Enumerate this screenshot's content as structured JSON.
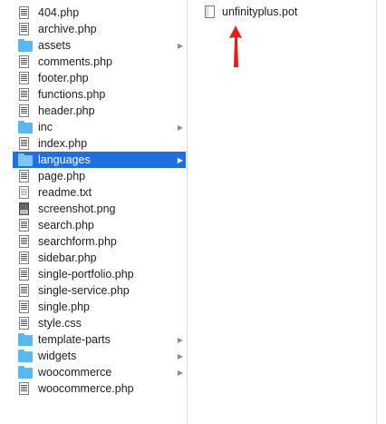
{
  "window": {
    "colors": {
      "selection": "#1f6fe0",
      "folder": "#5ab7f0",
      "arrow": "#e0201a"
    }
  },
  "left_column": {
    "items": [
      {
        "name": "404.php",
        "kind": "php",
        "icon": "php-file-icon",
        "folder": false
      },
      {
        "name": "archive.php",
        "kind": "php",
        "icon": "php-file-icon",
        "folder": false
      },
      {
        "name": "assets",
        "kind": "folder",
        "icon": "folder-icon",
        "folder": true
      },
      {
        "name": "comments.php",
        "kind": "php",
        "icon": "php-file-icon",
        "folder": false
      },
      {
        "name": "footer.php",
        "kind": "php",
        "icon": "php-file-icon",
        "folder": false
      },
      {
        "name": "functions.php",
        "kind": "php",
        "icon": "php-file-icon",
        "folder": false
      },
      {
        "name": "header.php",
        "kind": "php",
        "icon": "php-file-icon",
        "folder": false
      },
      {
        "name": "inc",
        "kind": "folder",
        "icon": "folder-icon",
        "folder": true
      },
      {
        "name": "index.php",
        "kind": "php",
        "icon": "php-file-icon",
        "folder": false
      },
      {
        "name": "languages",
        "kind": "folder",
        "icon": "folder-icon",
        "folder": true,
        "selected": true
      },
      {
        "name": "page.php",
        "kind": "php",
        "icon": "php-file-icon",
        "folder": false
      },
      {
        "name": "readme.txt",
        "kind": "txt",
        "icon": "text-file-icon",
        "folder": false
      },
      {
        "name": "screenshot.png",
        "kind": "png",
        "icon": "image-file-icon",
        "folder": false
      },
      {
        "name": "search.php",
        "kind": "php",
        "icon": "php-file-icon",
        "folder": false
      },
      {
        "name": "searchform.php",
        "kind": "php",
        "icon": "php-file-icon",
        "folder": false
      },
      {
        "name": "sidebar.php",
        "kind": "php",
        "icon": "php-file-icon",
        "folder": false
      },
      {
        "name": "single-portfolio.php",
        "kind": "php",
        "icon": "php-file-icon",
        "folder": false
      },
      {
        "name": "single-service.php",
        "kind": "php",
        "icon": "php-file-icon",
        "folder": false
      },
      {
        "name": "single.php",
        "kind": "php",
        "icon": "php-file-icon",
        "folder": false
      },
      {
        "name": "style.css",
        "kind": "css",
        "icon": "css-file-icon",
        "folder": false
      },
      {
        "name": "template-parts",
        "kind": "folder",
        "icon": "folder-icon",
        "folder": true
      },
      {
        "name": "widgets",
        "kind": "folder",
        "icon": "folder-icon",
        "folder": true
      },
      {
        "name": "woocommerce",
        "kind": "folder",
        "icon": "folder-icon",
        "folder": true
      },
      {
        "name": "woocommerce.php",
        "kind": "php",
        "icon": "php-file-icon",
        "folder": false
      }
    ]
  },
  "right_column": {
    "items": [
      {
        "name": "unfinityplus.pot",
        "icon": "pot-file-icon"
      }
    ]
  },
  "annotation": {
    "icon": "red-arrow-icon"
  }
}
